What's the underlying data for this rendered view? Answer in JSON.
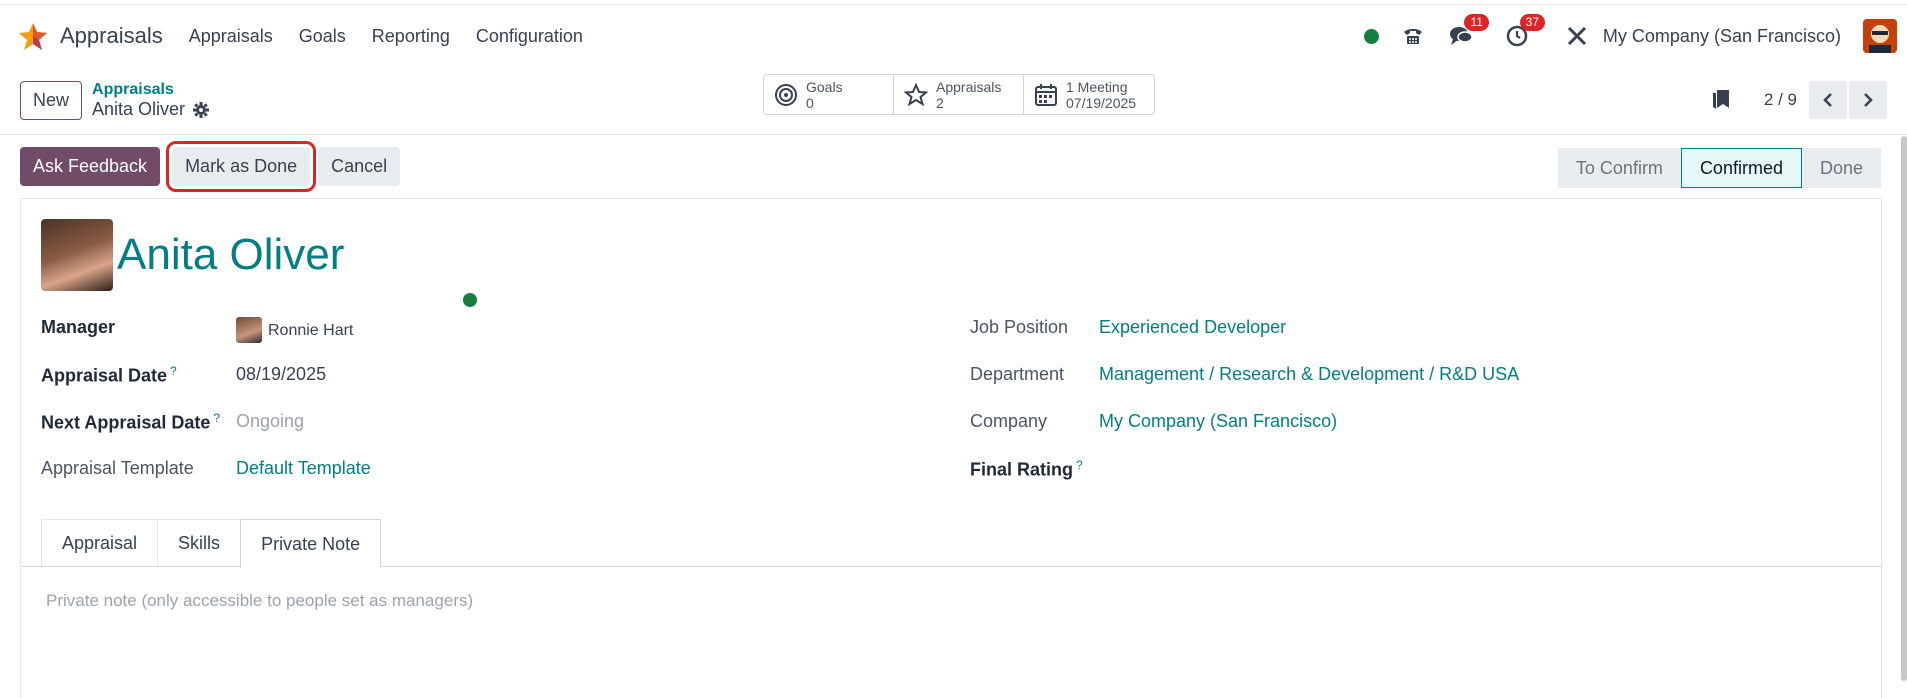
{
  "app": {
    "name": "Appraisals"
  },
  "menu": [
    "Appraisals",
    "Goals",
    "Reporting",
    "Configuration"
  ],
  "systray": {
    "chat_count": "11",
    "activity_count": "37",
    "company": "My Company (San Francisco)"
  },
  "control": {
    "new_label": "New",
    "breadcrumb_parent": "Appraisals",
    "breadcrumb_current": "Anita Oliver",
    "smart_buttons": [
      {
        "title": "Goals",
        "value": "0",
        "icon": "target-icon"
      },
      {
        "title": "Appraisals",
        "value": "2",
        "icon": "star-icon"
      },
      {
        "title": "1 Meeting",
        "value": "07/19/2025",
        "icon": "calendar-icon"
      }
    ],
    "pager": "2 / 9"
  },
  "actions": {
    "ask_feedback": "Ask Feedback",
    "mark_done": "Mark as Done",
    "cancel": "Cancel"
  },
  "statusbar": [
    "To Confirm",
    "Confirmed",
    "Done"
  ],
  "statusbar_active": "Confirmed",
  "form": {
    "employee_name": "Anita Oliver",
    "left": {
      "manager_label": "Manager",
      "manager_value": "Ronnie Hart",
      "appraisal_date_label": "Appraisal Date",
      "appraisal_date_value": "08/19/2025",
      "next_date_label": "Next Appraisal Date",
      "next_date_value": "Ongoing",
      "template_label": "Appraisal Template",
      "template_value": "Default Template"
    },
    "right": {
      "job_label": "Job Position",
      "job_value": "Experienced Developer",
      "dept_label": "Department",
      "dept_value": "Management / Research & Development / R&D USA",
      "company_label": "Company",
      "company_value": "My Company (San Francisco)",
      "rating_label": "Final Rating"
    },
    "tabs": [
      "Appraisal",
      "Skills",
      "Private Note"
    ],
    "active_tab": "Private Note",
    "note_placeholder": "Private note (only accessible to people set as managers)"
  },
  "colors": {
    "brand": "#714b67",
    "link": "#017e84",
    "highlight": "#dc2626"
  }
}
